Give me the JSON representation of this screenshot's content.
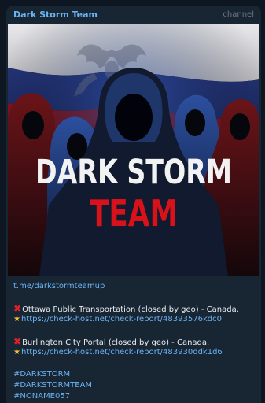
{
  "header": {
    "channel_name": "Dark Storm Team",
    "channel_tag": "channel"
  },
  "media": {
    "title_line1": "DARK STORM",
    "title_line2": "TEAM",
    "colors": {
      "flag_white": "#e8e8ec",
      "flag_blue": "#2a3c8c",
      "flag_red": "#b21a22",
      "title_white": "#f2f2f2",
      "title_red": "#d8121b"
    }
  },
  "message": {
    "channel_link": "t.me/darkstormteamup",
    "entries": [
      {
        "status_icon": "red-x-icon",
        "text": "Ottawa Public Transportation  (closed by geo) - Canada.",
        "link_icon": "star-icon",
        "link": "https://check-host.net/check-report/48393576kdc0"
      },
      {
        "status_icon": "red-x-icon",
        "text": "Burlington City Portal (closed by geo) - Canada.",
        "link_icon": "star-icon",
        "link": "https://check-host.net/check-report/483930ddk1d6"
      }
    ],
    "hashtags": [
      "#DARKSTORM",
      "#DARKSTORMTEAM",
      "#NONAME057"
    ]
  }
}
